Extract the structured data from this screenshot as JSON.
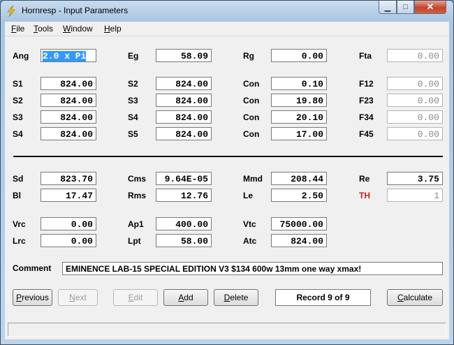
{
  "window": {
    "title": "Hornresp - Input Parameters",
    "min_glyph": "▁",
    "max_glyph": "□",
    "close_glyph": "✕"
  },
  "menu": {
    "file": {
      "key": "F",
      "rest": "ile"
    },
    "tools": {
      "key": "T",
      "rest": "ools"
    },
    "window": {
      "key": "W",
      "rest": "indow"
    },
    "help": {
      "key": "H",
      "rest": "elp"
    }
  },
  "labels": {
    "ang": "Ang",
    "eg": "Eg",
    "rg": "Rg",
    "fta": "Fta",
    "s1": "S1",
    "s2a": "S2",
    "con1": "Con",
    "f12": "F12",
    "s2b": "S2",
    "s3a": "S3",
    "con2": "Con",
    "f23": "F23",
    "s3b": "S3",
    "s4a": "S4",
    "con3": "Con",
    "f34": "F34",
    "s4b": "S4",
    "s5": "S5",
    "con4": "Con",
    "f45": "F45",
    "sd": "Sd",
    "cms": "Cms",
    "mmd": "Mmd",
    "re": "Re",
    "bl": "Bl",
    "rms": "Rms",
    "le": "Le",
    "th": "TH",
    "vrc": "Vrc",
    "ap1": "Ap1",
    "vtc": "Vtc",
    "lrc": "Lrc",
    "lpt": "Lpt",
    "atc": "Atc",
    "comment": "Comment"
  },
  "values": {
    "ang": "2.0 x Pi",
    "eg": "58.09",
    "rg": "0.00",
    "fta": "0.00",
    "s1": "824.00",
    "s2a": "824.00",
    "con1": "0.10",
    "f12": "0.00",
    "s2b": "824.00",
    "s3a": "824.00",
    "con2": "19.80",
    "f23": "0.00",
    "s3b": "824.00",
    "s4a": "824.00",
    "con3": "20.10",
    "f34": "0.00",
    "s4b": "824.00",
    "s5": "824.00",
    "con4": "17.00",
    "f45": "0.00",
    "sd": "823.70",
    "cms": "9.64E-05",
    "mmd": "208.44",
    "re": "3.75",
    "bl": "17.47",
    "rms": "12.76",
    "le": "2.50",
    "th": "1",
    "vrc": "0.00",
    "ap1": "400.00",
    "vtc": "75000.00",
    "lrc": "0.00",
    "lpt": "58.00",
    "atc": "824.00"
  },
  "comment_text": "EMINENCE LAB-15 SPECIAL EDITION V3 $134 600w 13mm one way xmax!",
  "buttons": {
    "previous": {
      "key": "P",
      "rest": "revious"
    },
    "next": {
      "key": "N",
      "rest": "ext"
    },
    "edit": {
      "key": "E",
      "rest": "dit"
    },
    "add": {
      "key": "A",
      "rest": "dd"
    },
    "delete": {
      "key": "D",
      "rest": "elete"
    },
    "calculate": {
      "key": "C",
      "rest": "alculate"
    }
  },
  "record": "Record 9 of 9",
  "colors": {
    "accent_red": "#c41e1e",
    "selection": "#3399ff"
  }
}
